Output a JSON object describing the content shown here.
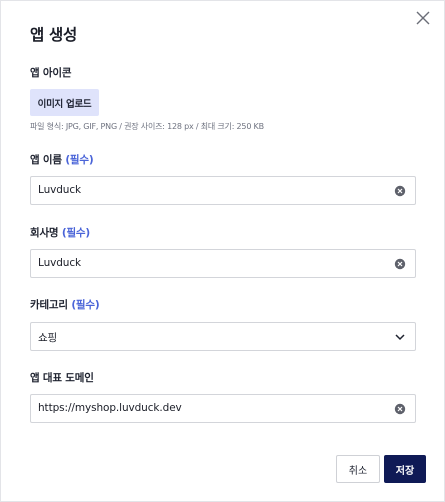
{
  "dialog": {
    "title": "앱 생성"
  },
  "app_icon": {
    "label": "앱 아이콘",
    "upload_label": "이미지 업로드",
    "hint": "파일 형식: JPG, GIF, PNG / 권장 사이즈: 128 px / 최대 크기: 250 KB"
  },
  "app_name": {
    "label": "앱 이름",
    "required": "(필수)",
    "value": "Luvduck"
  },
  "company": {
    "label": "회사명",
    "required": "(필수)",
    "value": "Luvduck"
  },
  "category": {
    "label": "카테고리",
    "required": "(필수)",
    "selected": "쇼핑"
  },
  "domain": {
    "label": "앱 대표 도메인",
    "value": "https://myshop.luvduck.dev"
  },
  "footer": {
    "cancel_label": "취소",
    "save_label": "저장"
  },
  "colors": {
    "primary": "#0f1a56",
    "required": "#4a64d8",
    "upload_bg": "#dfe3fb"
  },
  "icons": [
    "close-icon",
    "clear-icon",
    "chevron-down-icon"
  ]
}
